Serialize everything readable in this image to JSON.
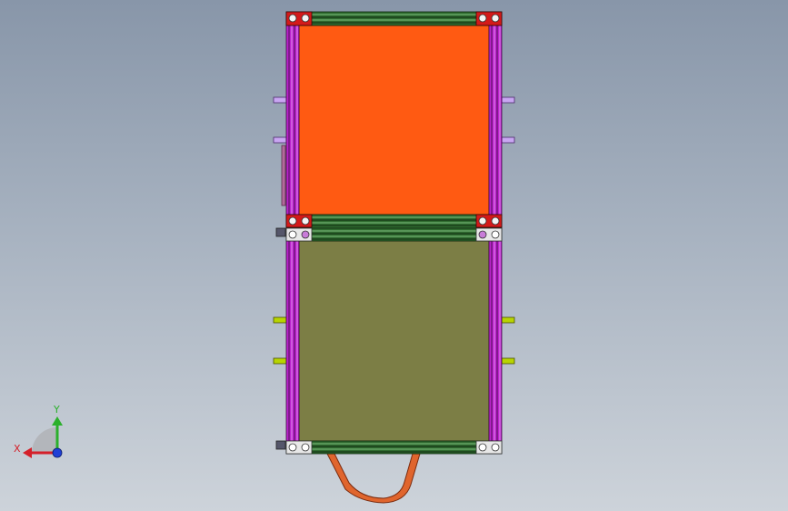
{
  "viewport": {
    "background_top": "#8896a9",
    "background_bottom": "#cdd3da"
  },
  "model": {
    "upper_panel_color": "#ff5a12",
    "lower_panel_color": "#7c7e45",
    "frame_rail_color": "#bb22cc",
    "crossbar_color": "#2f6a2f",
    "upper_tab_color": "#c9a6f2",
    "lower_tab_color": "#b8d400",
    "handle_color": "#e0652d"
  },
  "triad": {
    "x_label": "X",
    "y_label": "Y",
    "x_color": "#d4202a",
    "y_color": "#2bb02b",
    "z_color": "#1f3fd6"
  }
}
